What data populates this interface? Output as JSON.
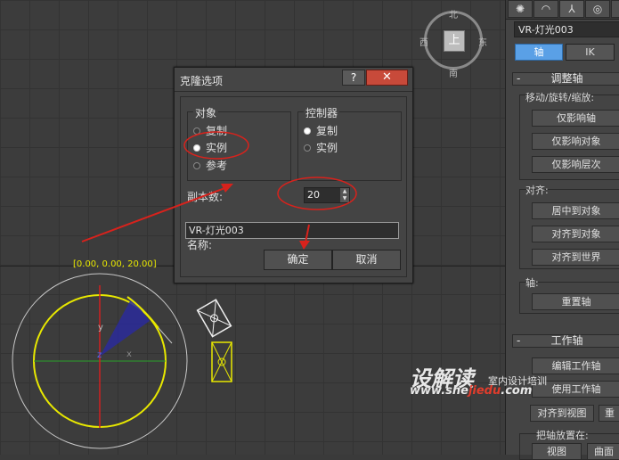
{
  "viewport": {
    "coord_label": "[0.00, 0.00, 20.00]",
    "viewcube": {
      "top_face": "上",
      "north": "北",
      "south": "南",
      "east": "东",
      "west": "西"
    },
    "axis_y": "y",
    "axis_z": "z",
    "axis_x": "x"
  },
  "dialog": {
    "title": "克隆选项",
    "help_label": "?",
    "close_label": "✕",
    "object_group": {
      "legend": "对象",
      "options": [
        "复制",
        "实例",
        "参考"
      ],
      "selected": "实例"
    },
    "controller_group": {
      "legend": "控制器",
      "options": [
        "复制",
        "实例"
      ],
      "selected": "复制"
    },
    "copies_label": "副本数:",
    "copies_value": "20",
    "name_label": "名称:",
    "name_value": "VR-灯光003",
    "ok_label": "确定",
    "cancel_label": "取消"
  },
  "panel": {
    "tabs": [
      "✺",
      "◠",
      "⅄",
      "◎",
      "▮"
    ],
    "object_name": "VR-灯光003",
    "mode_buttons": [
      "轴",
      "IK"
    ],
    "adjust_pivot": {
      "title": "调整轴",
      "move_group": "移动/旋转/缩放:",
      "move_buttons": [
        "仅影响轴",
        "仅影响对象",
        "仅影响层次"
      ],
      "align_group": "对齐:",
      "align_buttons": [
        "居中到对象",
        "对齐到对象",
        "对齐到世界"
      ],
      "axis_group": "轴:",
      "reset_button": "重置轴"
    },
    "working_pivot": {
      "title": "工作轴",
      "buttons": [
        "编辑工作轴",
        "使用工作轴"
      ],
      "align_view": "对齐到视图",
      "reset_partial": "重",
      "place_group": "把轴放置在:",
      "place_buttons": [
        "视图",
        "曲面"
      ]
    }
  },
  "watermark": {
    "brand": "设解读",
    "tagline": "室内设计培训",
    "url_prefix": "www.she",
    "url_red": "jiedu",
    "url_suffix": ".com"
  },
  "colors": {
    "annotation_red": "#d8221c",
    "active_blue": "#5aa0e6",
    "light_yellow": "#e8e800"
  }
}
